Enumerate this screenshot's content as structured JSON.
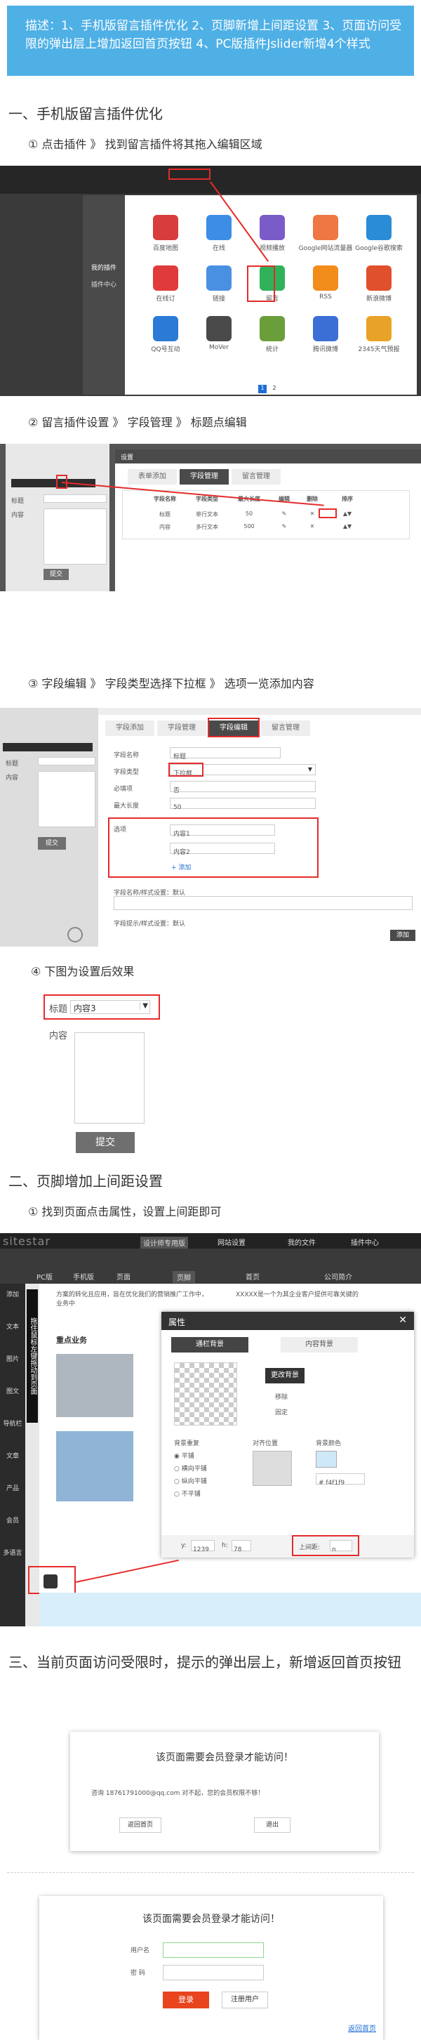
{
  "description": "描述：1、手机版留言插件优化 2、页脚新增上间距设置 3、页面访问受限的弹出层上增加返回首页按钮 4、PC版插件Jslider新增4个样式",
  "sections": {
    "s1": {
      "title": "一、手机版留言插件优化",
      "step1": "① 点击插件 》 找到留言插件将其拖入编辑区域",
      "step2": "② 留言插件设置 》 字段管理 》 标题点编辑",
      "step3": "③ 字段编辑 》  字段类型选择下拉框  》 选项一览添加内容",
      "step4": "④ 下图为设置后效果"
    },
    "s2": {
      "title": "二、页脚增加上间距设置",
      "step1": "① 找到页面点击属性，设置上间距即可"
    },
    "s3": {
      "title": "三、当前页面访问受限时，提示的弹出层上，新增返回首页按钮"
    }
  },
  "shot1": {
    "side_menu": [
      "我的插件",
      "插件中心"
    ],
    "plugins": [
      "百度地图",
      "在线",
      "视频播放",
      "Google网站流量器",
      "Google谷歌搜索",
      "在线订",
      "链接",
      "留言",
      "RSS",
      "新浪微博",
      "QQ号互动",
      "MoVer",
      "统计",
      "腾讯微博",
      "2345天气预报"
    ],
    "pages": [
      "1",
      "2"
    ]
  },
  "shot2": {
    "dialog_title": "设置",
    "tabs": [
      "表单添加",
      "字段管理",
      "留言管理"
    ],
    "table_headers": [
      "字段名称",
      "字段类型",
      "最大长度",
      "编辑",
      "删除",
      "排序"
    ],
    "rows": [
      [
        "标题",
        "单行文本",
        "50",
        "✎",
        "✕",
        "▲▼"
      ],
      [
        "内容",
        "多行文本",
        "500",
        "✎",
        "✕",
        "▲▼"
      ]
    ],
    "form_labels": [
      "标题",
      "内容"
    ],
    "submit": "提交"
  },
  "shot3": {
    "tabs": [
      "字段添加",
      "字段管理",
      "字段编辑",
      "留言管理"
    ],
    "labels": [
      "字段名称",
      "字段类型",
      "必填项",
      "最大长度",
      "选项"
    ],
    "values": [
      "标题",
      "下拉框",
      "否",
      "50"
    ],
    "options": [
      "内容1",
      "内容2"
    ],
    "add_link": "+ 添加",
    "setting1": "字段名称/样式设置：默认",
    "setting2": "字段提示/样式设置：默认",
    "form_labels": [
      "标题",
      "内容"
    ],
    "submit": "提交",
    "ok": "添加"
  },
  "shot4": {
    "label_title": "标题",
    "select_value": "内容3",
    "label_content": "内容",
    "submit": "提交"
  },
  "shot5": {
    "logo": "sitestar",
    "top_menu": [
      "设计师专用版",
      "网站设置",
      "我的文件",
      "插件中心"
    ],
    "device": [
      "PC版",
      "手机版"
    ],
    "page_tabs": [
      "页面",
      "页脚"
    ],
    "breadcrumb": "首页",
    "company": "公司简介",
    "left_tools": [
      "添加",
      "文本",
      "图片",
      "图文",
      "导航栏",
      "文章",
      "产品",
      "会员",
      "多语言"
    ],
    "side_hint": "拖住鼠标左键拖动到页面",
    "content_text": "方案的转化且应用，旨在优化我们的营销推广工作中，业务中",
    "content_text2": "XXXXX是一个为其企业客户提供可靠关键的",
    "key_business": "重点业务",
    "dialog": {
      "title": "属性",
      "tabs": [
        "通栏背景",
        "内容背景"
      ],
      "change_bg": "更改背景",
      "remove": "移除",
      "fixed": "固定",
      "repeat_title": "背景重复",
      "repeat_opts": [
        "平铺",
        "横向平铺",
        "纵向平铺",
        "不平铺"
      ],
      "align_title": "对齐位置",
      "color_title": "背景颜色",
      "color_value": "# f4f1f9",
      "y_label": "y:",
      "y_val": "1239",
      "h_label": "h:",
      "h_val": "78",
      "margin_label": "上间距:",
      "margin_val": "n"
    }
  },
  "shot6": {
    "msg": "该页面需要会员登录才能访问！",
    "contact": "咨询 18761791000@qq.com  对不起，您的会员权限不够！",
    "back": "返回首页",
    "leave": "退出"
  },
  "shot7": {
    "msg": "该页面需要会员登录才能访问！",
    "user_label": "用户名",
    "pass_label": "密 码",
    "login": "登录",
    "register": "注册用户",
    "back": "返回首页"
  }
}
